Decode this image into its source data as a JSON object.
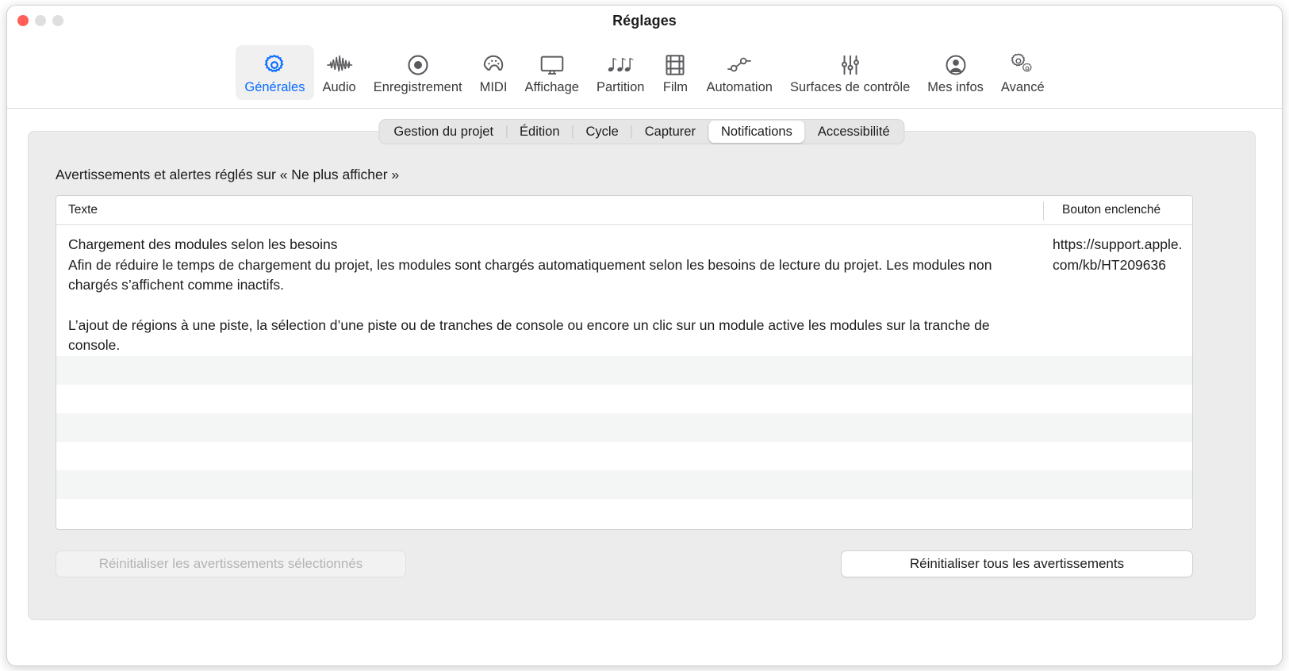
{
  "window": {
    "title": "Réglages",
    "traffic_lights": [
      "close",
      "minimize",
      "maximize"
    ]
  },
  "toolbar": {
    "items": [
      {
        "label": "Générales",
        "icon": "gear-icon",
        "active": true
      },
      {
        "label": "Audio",
        "icon": "waveform-icon",
        "active": false
      },
      {
        "label": "Enregistrement",
        "icon": "record-icon",
        "active": false
      },
      {
        "label": "MIDI",
        "icon": "midi-connector-icon",
        "active": false
      },
      {
        "label": "Affichage",
        "icon": "display-icon",
        "active": false
      },
      {
        "label": "Partition",
        "icon": "music-notes-icon",
        "active": false
      },
      {
        "label": "Film",
        "icon": "film-strip-icon",
        "active": false
      },
      {
        "label": "Automation",
        "icon": "automation-nodes-icon",
        "active": false
      },
      {
        "label": "Surfaces de contrôle",
        "icon": "sliders-icon",
        "active": false
      },
      {
        "label": "Mes infos",
        "icon": "person-circle-icon",
        "active": false
      },
      {
        "label": "Avancé",
        "icon": "double-gear-icon",
        "active": false
      }
    ]
  },
  "tabs": {
    "items": [
      {
        "label": "Gestion du projet",
        "selected": false
      },
      {
        "label": "Édition",
        "selected": false
      },
      {
        "label": "Cycle",
        "selected": false
      },
      {
        "label": "Capturer",
        "selected": false
      },
      {
        "label": "Notifications",
        "selected": true
      },
      {
        "label": "Accessibilité",
        "selected": false
      }
    ]
  },
  "content": {
    "heading": "Avertissements et alertes réglés sur « Ne plus afficher »",
    "table": {
      "columns": [
        "Texte",
        "Bouton enclenché"
      ],
      "rows": [
        {
          "title": "Chargement des modules selon les besoins",
          "paragraph1": "Afin de réduire le temps de chargement du projet, les modules sont chargés automatiquement selon les besoins de lecture du projet. Les modules non chargés s’affichent comme inactifs.",
          "paragraph2": "L’ajout de régions à une piste, la sélection d’une piste ou de tranches de console ou encore un clic sur un module active les modules sur la tranche de console.",
          "button": "https://support.apple.com/kb/HT209636"
        }
      ],
      "empty_row_count": 6
    }
  },
  "footer": {
    "reset_selected_label": "Réinitialiser les avertissements sélectionnés",
    "reset_selected_enabled": false,
    "reset_all_label": "Réinitialiser tous les avertissements",
    "reset_all_enabled": true
  },
  "colors": {
    "accent": "#0a6cff",
    "close": "#ff5f57",
    "panel": "#ececec",
    "stripe": "#f4f5f5"
  }
}
